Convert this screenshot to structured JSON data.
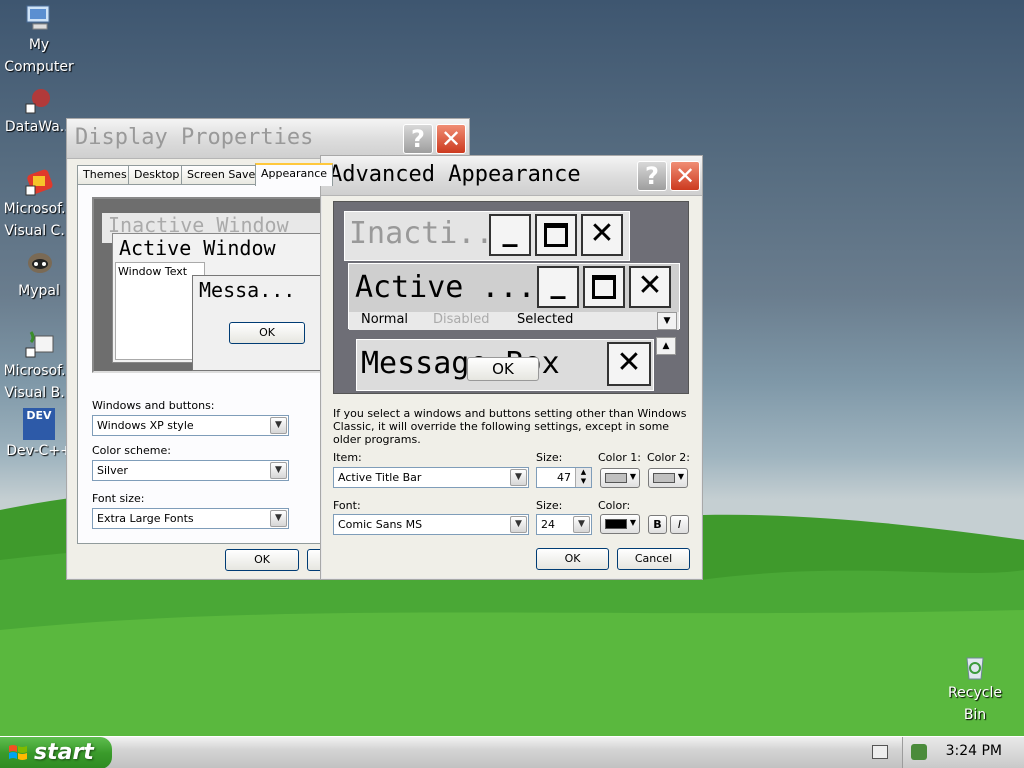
{
  "desktop": {
    "icons": [
      {
        "label1": "My",
        "label2": "Computer",
        "icon": "my-computer-icon"
      },
      {
        "label1": "DataWa...",
        "label2": "",
        "icon": "datawa-shortcut-icon"
      },
      {
        "label1": "Microsof...",
        "label2": "Visual C...",
        "icon": "visual-c-shortcut-icon"
      },
      {
        "label1": "Mypal",
        "label2": "",
        "icon": "mypal-shortcut-icon"
      },
      {
        "label1": "Microsof...",
        "label2": "Visual B...",
        "icon": "visual-basic-shortcut-icon"
      },
      {
        "label1": "Dev-C++",
        "label2": "",
        "icon": "dev-cpp-shortcut-icon"
      }
    ],
    "recycle_bin": {
      "label1": "Recycle",
      "label2": "Bin"
    },
    "dev_icon_text": "DEV"
  },
  "display_properties": {
    "title": "Display Properties",
    "tabs": [
      "Themes",
      "Desktop",
      "Screen Saver",
      "Appearance"
    ],
    "active_tab": "Appearance",
    "preview": {
      "inactive_window": "Inactive Window",
      "active_window": "Active Window",
      "window_text": "Window Text",
      "message_box": "Messa...",
      "ok": "OK"
    },
    "windows_and_buttons_label": "Windows and buttons:",
    "windows_and_buttons_value": "Windows XP style",
    "color_scheme_label": "Color scheme:",
    "color_scheme_value": "Silver",
    "font_size_label": "Font size:",
    "font_size_value": "Extra Large Fonts",
    "ok": "OK"
  },
  "advanced_appearance": {
    "title": "Advanced Appearance",
    "preview": {
      "inactive": "Inacti...",
      "active": "Active ...",
      "normal": "Normal",
      "disabled": "Disabled",
      "selected": "Selected",
      "message_box": "Message Box",
      "ok": "OK"
    },
    "note": "If you select a windows and buttons setting other than Windows Classic, it will override the following settings, except in some older programs.",
    "item_label": "Item:",
    "item_value": "Active Title Bar",
    "item_size_label": "Size:",
    "item_size_value": "47",
    "color1_label": "Color 1:",
    "color2_label": "Color 2:",
    "font_label": "Font:",
    "font_value": "Comic Sans MS",
    "font_size_label": "Size:",
    "font_size_value": "24",
    "font_color_label": "Color:",
    "bold": "B",
    "italic": "I",
    "ok": "OK",
    "cancel": "Cancel",
    "colors": {
      "color1": "#c0c0c0",
      "color2": "#c0c0c0",
      "font_color": "#000000"
    }
  },
  "taskbar": {
    "start_label": "start",
    "clock": "3:24 PM"
  }
}
